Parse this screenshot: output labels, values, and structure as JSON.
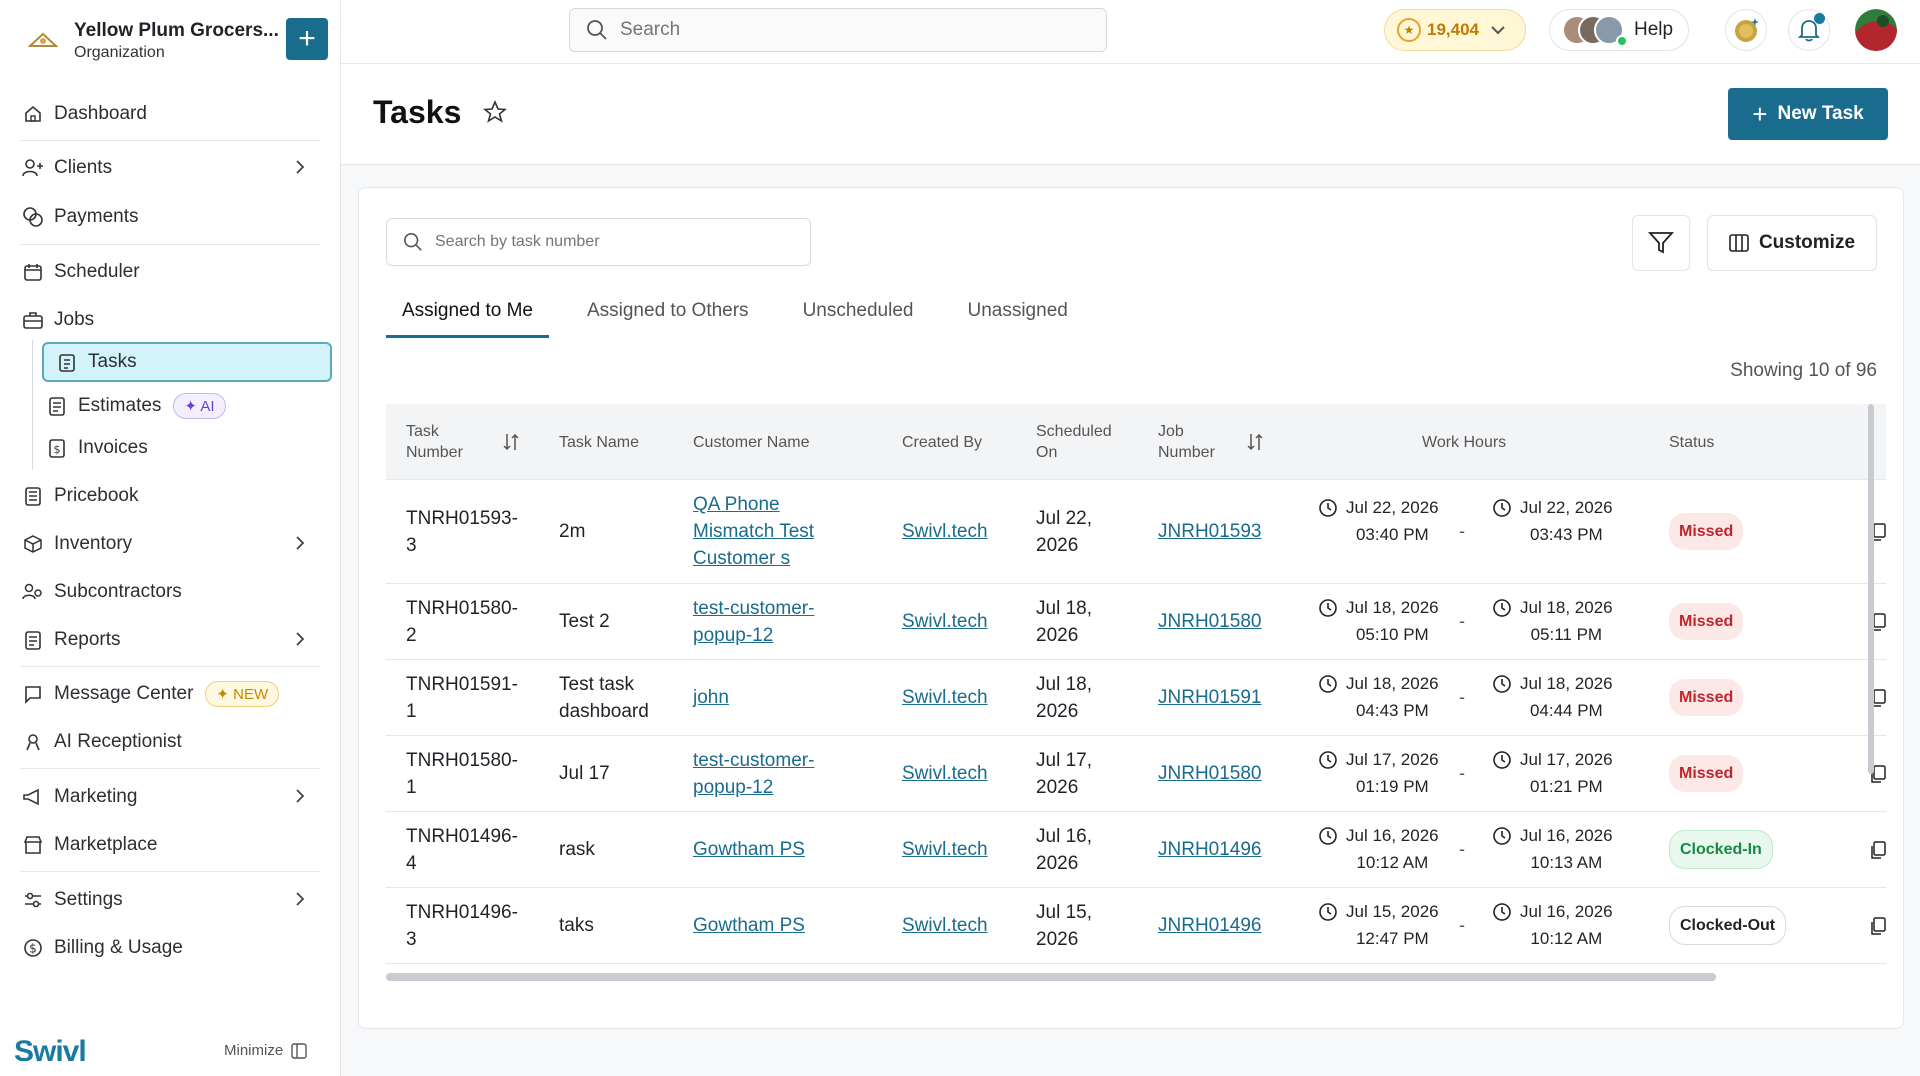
{
  "org": {
    "name": "Yellow Plum Grocers...",
    "subtitle": "Organization",
    "add_label": "+"
  },
  "sidebar": {
    "items": [
      {
        "label": "Dashboard"
      },
      {
        "label": "Clients"
      },
      {
        "label": "Payments"
      },
      {
        "label": "Scheduler"
      },
      {
        "label": "Jobs"
      },
      {
        "label": "Tasks"
      },
      {
        "label": "Estimates",
        "badge": "AI"
      },
      {
        "label": "Invoices"
      },
      {
        "label": "Pricebook"
      },
      {
        "label": "Inventory"
      },
      {
        "label": "Subcontractors"
      },
      {
        "label": "Reports"
      },
      {
        "label": "Message Center",
        "badge": "NEW"
      },
      {
        "label": "AI Receptionist"
      },
      {
        "label": "Marketing"
      },
      {
        "label": "Marketplace"
      },
      {
        "label": "Settings"
      },
      {
        "label": "Billing & Usage"
      }
    ],
    "brand": "Swivl",
    "minimize_label": "Minimize"
  },
  "topbar": {
    "search_placeholder": "Search",
    "credits": "19,404",
    "help_label": "Help"
  },
  "page": {
    "title": "Tasks",
    "new_task_label": "New Task"
  },
  "filters": {
    "search_placeholder": "Search by task number",
    "customize_label": "Customize"
  },
  "tabs": [
    {
      "label": "Assigned to Me",
      "active": true
    },
    {
      "label": "Assigned to Others",
      "active": false
    },
    {
      "label": "Unscheduled",
      "active": false
    },
    {
      "label": "Unassigned",
      "active": false
    }
  ],
  "showing": "Showing 10 of 96",
  "table": {
    "columns": {
      "task_number": "Task Number",
      "task_name": "Task Name",
      "customer_name": "Customer Name",
      "created_by": "Created By",
      "scheduled_on": "Scheduled On",
      "job_number": "Job Number",
      "work_hours": "Work Hours",
      "status": "Status"
    },
    "rows": [
      {
        "task_number_a": "TNRH01593-",
        "task_number_b": "3",
        "task_name": "2m",
        "customer": [
          "QA Phone",
          "Mismatch Test",
          "Customer s"
        ],
        "created_by": "Swivl.tech",
        "sched_a": "Jul 22,",
        "sched_b": "2026",
        "job": "JNRH01593",
        "start_date": "Jul 22, 2026",
        "start_time": "03:40 PM",
        "end_date": "Jul 22, 2026",
        "end_time": "03:43 PM",
        "status": "Missed"
      },
      {
        "task_number_a": "TNRH01580-",
        "task_number_b": "2",
        "task_name": "Test 2",
        "customer": [
          "test-customer-",
          "popup-12"
        ],
        "created_by": "Swivl.tech",
        "sched_a": "Jul 18,",
        "sched_b": "2026",
        "job": "JNRH01580",
        "start_date": "Jul 18, 2026",
        "start_time": "05:10 PM",
        "end_date": "Jul 18, 2026",
        "end_time": "05:11 PM",
        "status": "Missed"
      },
      {
        "task_number_a": "TNRH01591-",
        "task_number_b": "1",
        "task_name_a": "Test task",
        "task_name_b": "dashboard",
        "customer": [
          "john"
        ],
        "created_by": "Swivl.tech",
        "sched_a": "Jul 18,",
        "sched_b": "2026",
        "job": "JNRH01591",
        "start_date": "Jul 18, 2026",
        "start_time": "04:43 PM",
        "end_date": "Jul 18, 2026",
        "end_time": "04:44 PM",
        "status": "Missed"
      },
      {
        "task_number_a": "TNRH01580-",
        "task_number_b": "1",
        "task_name": "Jul 17",
        "customer": [
          "test-customer-",
          "popup-12"
        ],
        "created_by": "Swivl.tech",
        "sched_a": "Jul 17,",
        "sched_b": "2026",
        "job": "JNRH01580",
        "start_date": "Jul 17, 2026",
        "start_time": "01:19 PM",
        "end_date": "Jul 17, 2026",
        "end_time": "01:21 PM",
        "status": "Missed"
      },
      {
        "task_number_a": "TNRH01496-",
        "task_number_b": "4",
        "task_name": "rask",
        "customer": [
          "Gowtham PS"
        ],
        "created_by": "Swivl.tech",
        "sched_a": "Jul 16,",
        "sched_b": "2026",
        "job": "JNRH01496",
        "start_date": "Jul 16, 2026",
        "start_time": "10:12 AM",
        "end_date": "Jul 16, 2026",
        "end_time": "10:13 AM",
        "status": "Clocked-In"
      },
      {
        "task_number_a": "TNRH01496-",
        "task_number_b": "3",
        "task_name": "taks",
        "customer": [
          "Gowtham PS"
        ],
        "created_by": "Swivl.tech",
        "sched_a": "Jul 15,",
        "sched_b": "2026",
        "job": "JNRH01496",
        "start_date": "Jul 15, 2026",
        "start_time": "12:47 PM",
        "end_date": "Jul 16, 2026",
        "end_time": "10:12 AM",
        "status": "Clocked-Out"
      }
    ],
    "dash": "-"
  },
  "colors": {
    "accent": "#1a6c8e",
    "missed": "#c0262d",
    "clocked_in": "#178a43"
  }
}
